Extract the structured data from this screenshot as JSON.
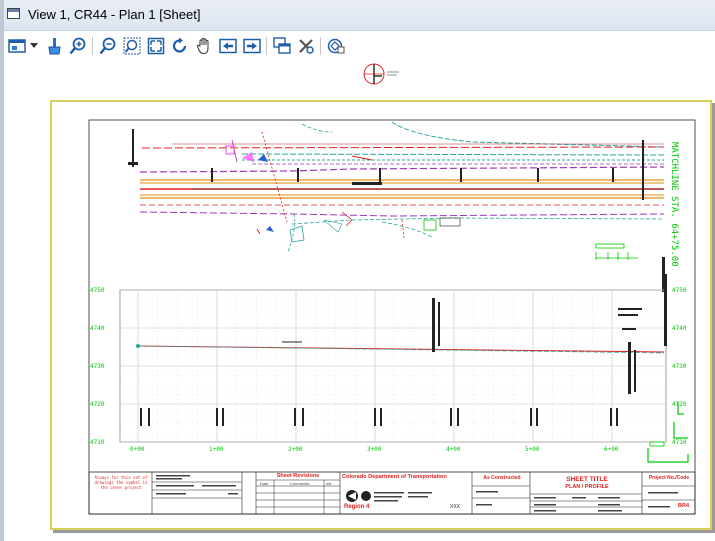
{
  "window": {
    "title": "View 1, CR44 - Plan 1 [Sheet]"
  },
  "toolbar": {
    "items": [
      {
        "name": "view-attributes-button",
        "icon": "view-attributes-icon"
      },
      {
        "name": "view-attributes-dropdown",
        "icon": "chevron-down-icon"
      },
      {
        "name": "update-view-button",
        "icon": "brush-icon"
      },
      {
        "name": "zoom-in-button",
        "icon": "zoom-in-icon"
      },
      {
        "name": "zoom-out-button",
        "icon": "zoom-out-icon"
      },
      {
        "name": "window-area-button",
        "icon": "window-area-icon"
      },
      {
        "name": "fit-view-button",
        "icon": "fit-view-icon"
      },
      {
        "name": "rotate-view-button",
        "icon": "rotate-icon"
      },
      {
        "name": "pan-view-button",
        "icon": "pan-hand-icon"
      },
      {
        "name": "previous-view-button",
        "icon": "arrow-left-icon"
      },
      {
        "name": "next-view-button",
        "icon": "arrow-right-icon"
      },
      {
        "name": "copy-view-button",
        "icon": "copy-view-icon"
      },
      {
        "name": "view-tools-button",
        "icon": "tools-icon"
      },
      {
        "name": "camera-button",
        "icon": "camera-icon"
      }
    ]
  },
  "sheet": {
    "matchline": "MATCHLINE STA. 64+75.00",
    "profile": {
      "elevations_left": [
        "4750",
        "4740",
        "4730",
        "4720",
        "4710"
      ],
      "elevations_right": [
        "4750",
        "4740",
        "4730",
        "4720",
        "4710"
      ],
      "stations": [
        "0+00",
        "1+00",
        "2+00",
        "3+00",
        "4+00",
        "5+00",
        "6+00"
      ]
    },
    "title_block": {
      "note": "Always for this set of drawings the symbol is the cover project",
      "revisions_title": "Sheet Revisions",
      "revisions_cols": [
        "Date",
        "Comments",
        "Init."
      ],
      "agency": "Colorado Department of Transportation",
      "region": "Region 4",
      "xxx": "XXX",
      "as_constructed": "As Constructed",
      "sheet_title": "SHEET TITLE",
      "sheet_subtitle": "PLAN / PROFILE",
      "project_label": "Project No./Code",
      "sheet_number": "BR4"
    }
  },
  "colors": {
    "sheet_border": "#d9cf5b",
    "grid": "#bfbfbf",
    "profile_text": "#00c800",
    "red": "#e02020",
    "teal": "#2aa6a0",
    "purple": "#9a3bb4",
    "orange": "#e6a23c",
    "dark_red": "#b02828"
  }
}
